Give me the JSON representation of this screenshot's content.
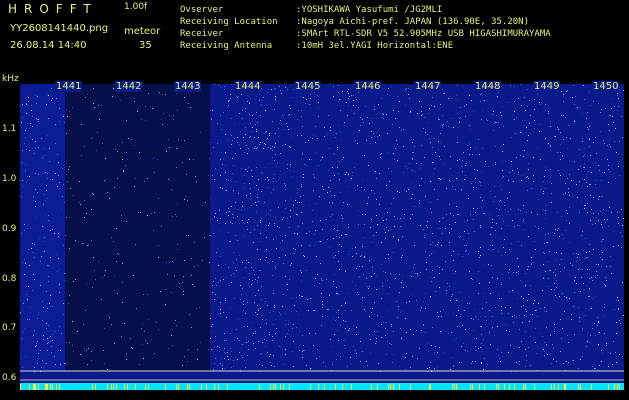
{
  "header": {
    "app_title": "HROFFT",
    "app_version": "1.00f",
    "filename": "YY2608141440.png",
    "datetime": "26.08.14 14:40",
    "meteor_label": "meteor",
    "meteor_count": "35"
  },
  "station": [
    {
      "label": "Ovserver",
      "value": ":YOSHIKAWA Yasufumi /JG2MLI"
    },
    {
      "label": "Receiving Location",
      "value": ":Nagoya Aichi-pref. JAPAN (136.90E, 35.20N)"
    },
    {
      "label": "Receiver",
      "value": ":SMArt RTL-SDR V5 52.905MHz USB HIGASHIMURAYAMA"
    },
    {
      "label": "Receiving Antenna",
      "value": ":10mH 3el.YAGI Horizontal:ENE"
    }
  ],
  "axis": {
    "y_unit": "kHz",
    "y_ticks": [
      "1.1",
      "1.0",
      "0.9",
      "0.8",
      "0.7",
      "0.6"
    ],
    "x_ticks": [
      "1441",
      "1442",
      "1443",
      "1444",
      "1445",
      "1446",
      "1447",
      "1448",
      "1449",
      "1450"
    ]
  },
  "colors": {
    "background": "#000000",
    "text": "#e6ee7a",
    "noise_base": "#0a1a8a",
    "baseline": "#00e5ff"
  }
}
